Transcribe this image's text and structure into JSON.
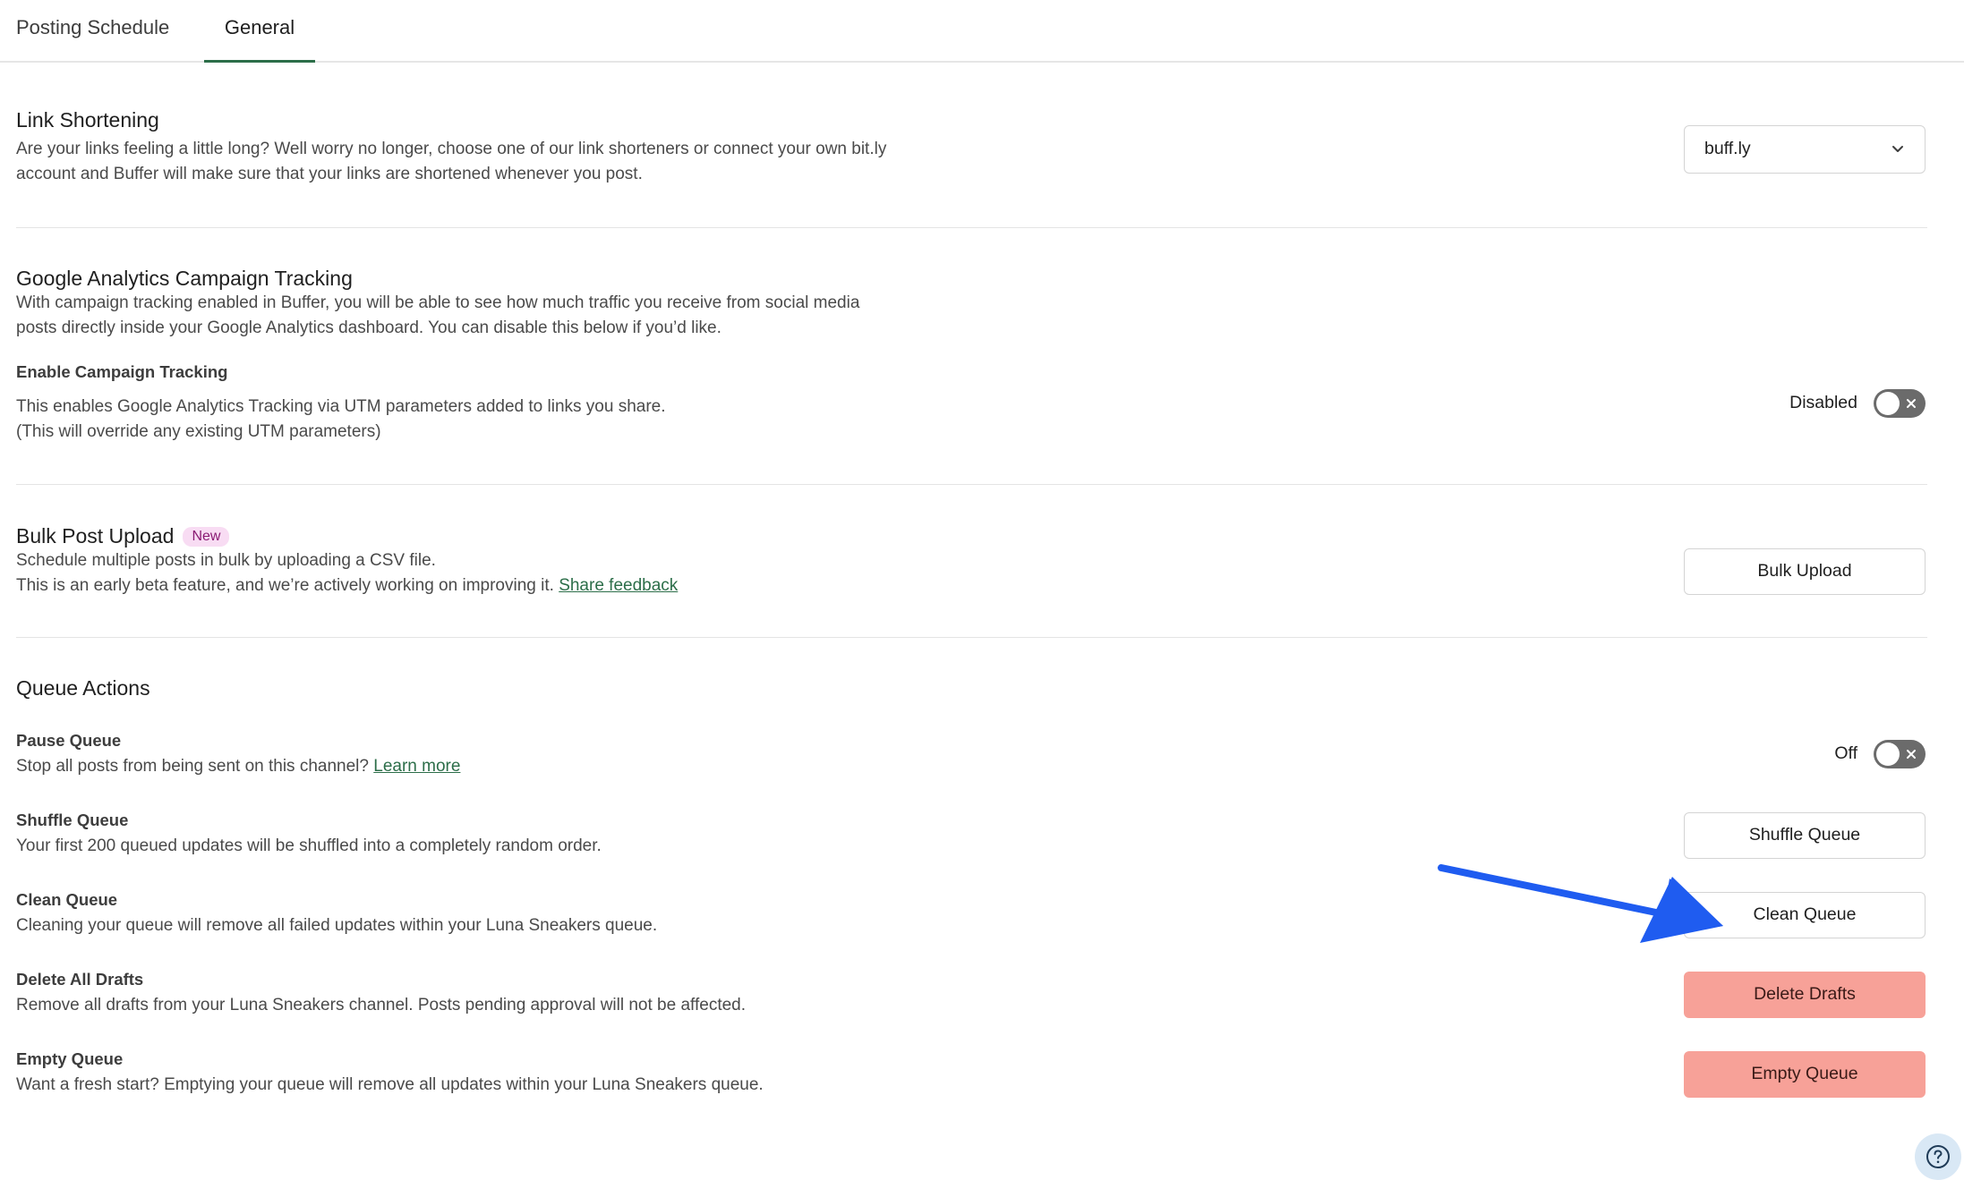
{
  "tabs": [
    {
      "label": "Posting Schedule",
      "active": false
    },
    {
      "label": "General",
      "active": true
    }
  ],
  "link_shortening": {
    "title": "Link Shortening",
    "description": "Are your links feeling a little long? Well worry no longer, choose one of our link shorteners or connect your own bit.ly account and Buffer will make sure that your links are shortened whenever you post.",
    "selected": "buff.ly",
    "icon": "chevron-down-icon"
  },
  "ga_tracking": {
    "title": "Google Analytics Campaign Tracking",
    "description": "With campaign tracking enabled in Buffer, you will be able to see how much traffic you receive from social media posts directly inside your Google Analytics dashboard. You can disable this below if you’d like.",
    "enable_title": "Enable Campaign Tracking",
    "enable_line1": "This enables Google Analytics Tracking via UTM parameters added to links you share.",
    "enable_line2": "(This will override any existing UTM parameters)",
    "toggle_label": "Disabled",
    "toggle_on": false
  },
  "bulk_upload": {
    "title": "Bulk Post Upload",
    "badge": "New",
    "line1": "Schedule multiple posts in bulk by uploading a CSV file.",
    "line2": "This is an early beta feature, and we’re actively working on improving it.",
    "feedback_link": "Share feedback",
    "button": "Bulk Upload"
  },
  "queue_actions": {
    "title": "Queue Actions",
    "pause": {
      "title": "Pause Queue",
      "description": "Stop all posts from being sent on this channel?",
      "link": "Learn more",
      "toggle_label": "Off",
      "toggle_on": false
    },
    "shuffle": {
      "title": "Shuffle Queue",
      "description": "Your first 200 queued updates will be shuffled into a completely random order.",
      "button": "Shuffle Queue"
    },
    "clean": {
      "title": "Clean Queue",
      "description": "Cleaning your queue will remove all failed updates within your Luna Sneakers queue.",
      "button": "Clean Queue"
    },
    "delete_drafts": {
      "title": "Delete All Drafts",
      "description": "Remove all drafts from your Luna Sneakers channel. Posts pending approval will not be affected.",
      "button": "Delete Drafts"
    },
    "empty": {
      "title": "Empty Queue",
      "description": "Want a fresh start? Emptying your queue will remove all updates within your Luna Sneakers queue.",
      "button": "Empty Queue"
    }
  },
  "colors": {
    "accent": "#2c6e49",
    "danger_button": "#f7a198",
    "arrow": "#1f5cf0",
    "badge_bg": "#f8dcf3"
  },
  "icons": {
    "toggle_off": "close-icon",
    "help": "question-circle-icon",
    "annotation": "arrow-icon"
  }
}
